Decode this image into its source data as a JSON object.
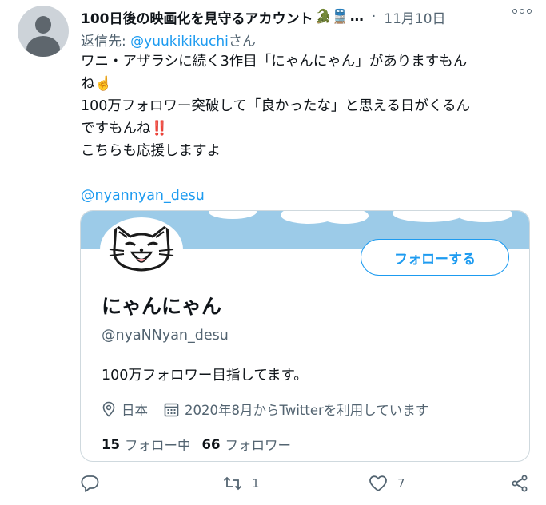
{
  "tweet": {
    "display_name": "100日後の映画化を見守るアカウント",
    "name_emoji": "🐊🚆",
    "ellipsis": "…",
    "separator": "·",
    "date": "11月10日",
    "reply_prefix": "返信先: ",
    "reply_mention": "@yuukikikuchi",
    "reply_suffix": "さん",
    "text_lines": [
      "ワニ・アザラシに続く3作目「にゃんにゃん」がありますもん",
      "ね☝️",
      "100万フォロワー突破して「良かったな」と思える日がくるん",
      "ですもんね‼️",
      "こちらも応援しますよ"
    ],
    "link": "@nyannyan_desu"
  },
  "card": {
    "follow_label": "フォローする",
    "name": "にゃんにゃん",
    "handle": "@nyaNNyan_desu",
    "bio": "100万フォロワー目指してます。",
    "location": "日本",
    "joined": "2020年8月からTwitterを利用しています",
    "following_count": "15",
    "following_label": "フォロー中",
    "followers_count": "66",
    "followers_label": "フォロワー"
  },
  "actions": {
    "retweet_count": "1",
    "like_count": "7"
  },
  "colors": {
    "accent": "#1d9bf0",
    "secondary_text": "#536471",
    "banner": "#9ccbe8"
  }
}
